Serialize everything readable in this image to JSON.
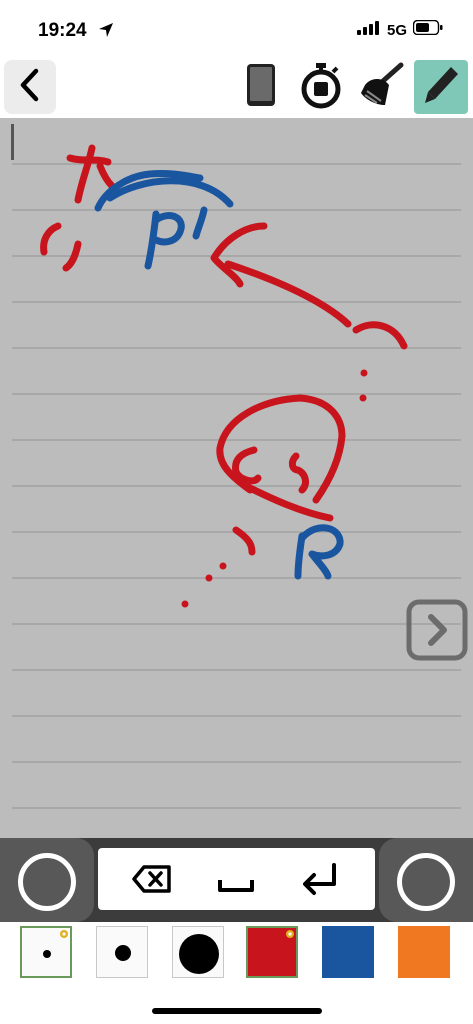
{
  "status": {
    "time": "19:24",
    "network": "5G"
  },
  "toolbar": {
    "back_icon": "chevron-left-icon",
    "tools": [
      "phone-icon",
      "stopwatch-icon",
      "broom-icon",
      "pencil-icon"
    ],
    "active_tool": "pencil-icon",
    "active_color": "#7fc7b6"
  },
  "canvas": {
    "background": "#bcbcbc",
    "line_color": "#9a9a9a"
  },
  "keys": {
    "items": [
      "backspace-icon",
      "space-icon",
      "enter-icon"
    ]
  },
  "palette": {
    "colors": {
      "red": "#c8141c",
      "blue": "#1a56a0",
      "orange": "#f07820"
    },
    "items": [
      "pen-size-small",
      "pen-size-medium",
      "pen-size-large",
      "color-red",
      "color-blue",
      "color-orange"
    ]
  }
}
